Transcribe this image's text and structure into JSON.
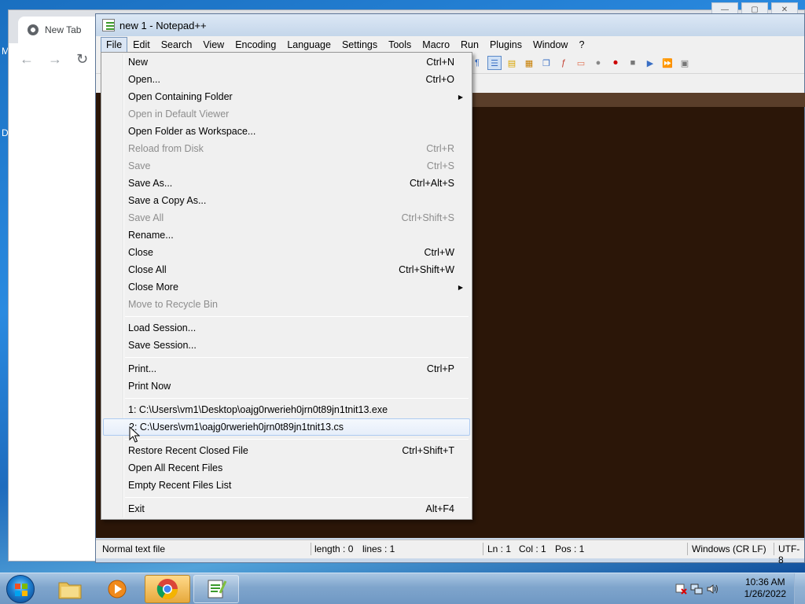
{
  "desktop": {
    "fragments": [
      "M",
      "D"
    ]
  },
  "browser": {
    "tab_label": "New Tab",
    "nav": {
      "back": "←",
      "forward": "→",
      "reload": "↻"
    }
  },
  "notepad": {
    "title": "new 1 - Notepad++",
    "menubar": [
      "File",
      "Edit",
      "Search",
      "View",
      "Encoding",
      "Language",
      "Settings",
      "Tools",
      "Macro",
      "Run",
      "Plugins",
      "Window",
      "?"
    ],
    "active_menu": "File",
    "status": {
      "type": "Normal text file",
      "length": "length : 0",
      "lines": "lines : 1",
      "ln": "Ln : 1",
      "col": "Col : 1",
      "pos": "Pos : 1",
      "eol": "Windows (CR LF)",
      "encoding": "UTF-8"
    }
  },
  "file_menu": {
    "items": [
      {
        "label": "New",
        "shortcut": "Ctrl+N",
        "disabled": false
      },
      {
        "label": "Open...",
        "shortcut": "Ctrl+O",
        "disabled": false
      },
      {
        "label": "Open Containing Folder",
        "shortcut": "",
        "submenu": true,
        "disabled": false
      },
      {
        "label": "Open in Default Viewer",
        "shortcut": "",
        "disabled": true
      },
      {
        "label": "Open Folder as Workspace...",
        "shortcut": "",
        "disabled": false
      },
      {
        "label": "Reload from Disk",
        "shortcut": "Ctrl+R",
        "disabled": true
      },
      {
        "label": "Save",
        "shortcut": "Ctrl+S",
        "disabled": true
      },
      {
        "label": "Save As...",
        "shortcut": "Ctrl+Alt+S",
        "disabled": false
      },
      {
        "label": "Save a Copy As...",
        "shortcut": "",
        "disabled": false
      },
      {
        "label": "Save All",
        "shortcut": "Ctrl+Shift+S",
        "disabled": true
      },
      {
        "label": "Rename...",
        "shortcut": "",
        "disabled": false
      },
      {
        "label": "Close",
        "shortcut": "Ctrl+W",
        "disabled": false
      },
      {
        "label": "Close All",
        "shortcut": "Ctrl+Shift+W",
        "disabled": false
      },
      {
        "label": "Close More",
        "shortcut": "",
        "submenu": true,
        "disabled": false
      },
      {
        "label": "Move to Recycle Bin",
        "shortcut": "",
        "disabled": true
      },
      {
        "label": "Load Session...",
        "shortcut": "",
        "disabled": false
      },
      {
        "label": "Save Session...",
        "shortcut": "",
        "disabled": false
      },
      {
        "label": "Print...",
        "shortcut": "Ctrl+P",
        "disabled": false
      },
      {
        "label": "Print Now",
        "shortcut": "",
        "disabled": false
      },
      {
        "label": "1: C:\\Users\\vm1\\Desktop\\oajg0rwerieh0jrn0t89jn1tnit13.exe",
        "shortcut": "",
        "disabled": false
      },
      {
        "label": "2: C:\\Users\\vm1\\oajg0rwerieh0jrn0t89jn1tnit13.cs",
        "shortcut": "",
        "disabled": false,
        "hover": true
      },
      {
        "label": "Restore Recent Closed File",
        "shortcut": "Ctrl+Shift+T",
        "disabled": false
      },
      {
        "label": "Open All Recent Files",
        "shortcut": "",
        "disabled": false
      },
      {
        "label": "Empty Recent Files List",
        "shortcut": "",
        "disabled": false
      },
      {
        "label": "Exit",
        "shortcut": "Alt+F4",
        "disabled": false
      }
    ]
  },
  "taskbar": {
    "apps": [
      {
        "name": "File Explorer",
        "icon": "folder-icon",
        "state": "pinned"
      },
      {
        "name": "Windows Media Player",
        "icon": "media-player-icon",
        "state": "pinned"
      },
      {
        "name": "Google Chrome",
        "icon": "chrome-icon",
        "state": "active"
      },
      {
        "name": "Notepad++",
        "icon": "notepadpp-icon",
        "state": "open"
      }
    ],
    "clock_time": "10:36 AM",
    "clock_date": "1/26/2022"
  }
}
